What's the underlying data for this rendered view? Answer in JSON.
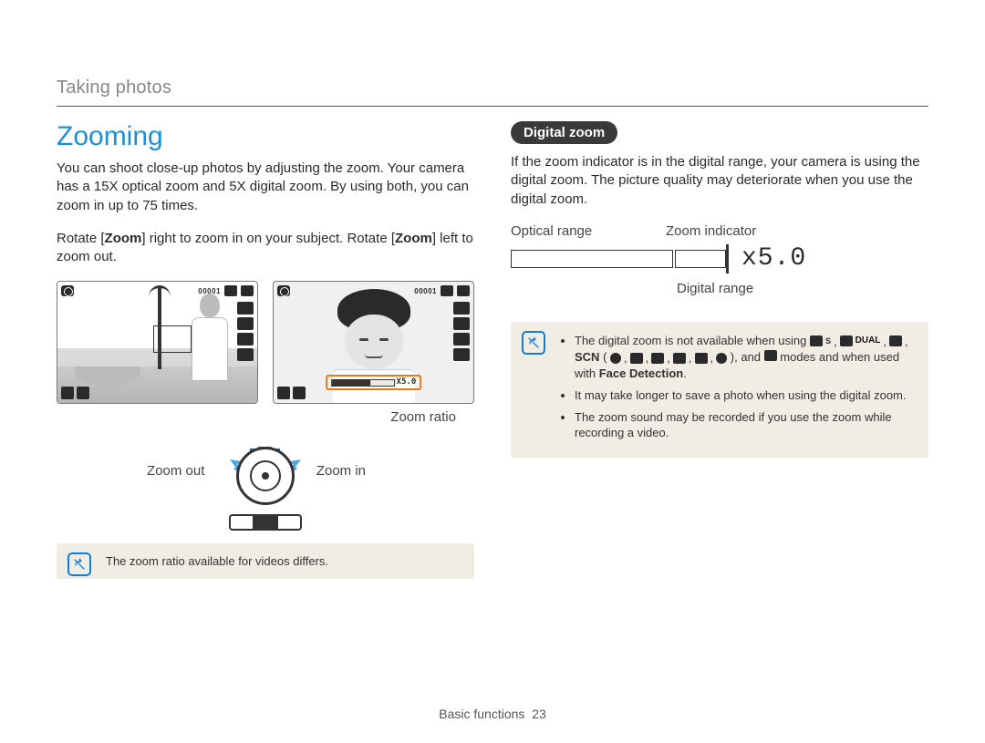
{
  "section": "Taking photos",
  "title": "Zooming",
  "left": {
    "p1": "You can shoot close-up photos by adjusting the zoom. Your camera has a 15X optical zoom and 5X digital zoom. By using both, you can zoom in up to 75 times.",
    "p2_a": "Rotate [",
    "p2_b": "Zoom",
    "p2_c": "] right to zoom in on your subject. Rotate [",
    "p2_d": "Zoom",
    "p2_e": "] left to zoom out.",
    "lcd_counter": "00001",
    "lcd_zoom_bar": "X5.0",
    "zoom_out": "Zoom out",
    "zoom_in": "Zoom in",
    "zoom_ratio": "Zoom ratio",
    "note1": "The zoom ratio available for videos differs."
  },
  "right": {
    "pill": "Digital zoom",
    "p1": "If the zoom indicator is in the digital range, your camera is using the digital zoom. The picture quality may deteriorate when you use the digital zoom.",
    "label_optical": "Optical range",
    "label_indicator": "Zoom indicator",
    "label_digital": "Digital range",
    "value": "x5.0",
    "note_li1_a": "The digital zoom is not available when using ",
    "note_li1_b": "SCN",
    "note_li1_c": " ( ",
    "note_li1_d": " ), and ",
    "note_li1_e": " modes and when used with ",
    "note_li1_bold": "Face Detection",
    "note_li1_f": ".",
    "note_li2": "It may take longer to save a photo when using the digital zoom.",
    "note_li3": "The zoom sound may be recorded if you use the zoom while recording a video.",
    "mode_dual": "DUAL"
  },
  "footer_section": "Basic functions",
  "footer_page": "23"
}
